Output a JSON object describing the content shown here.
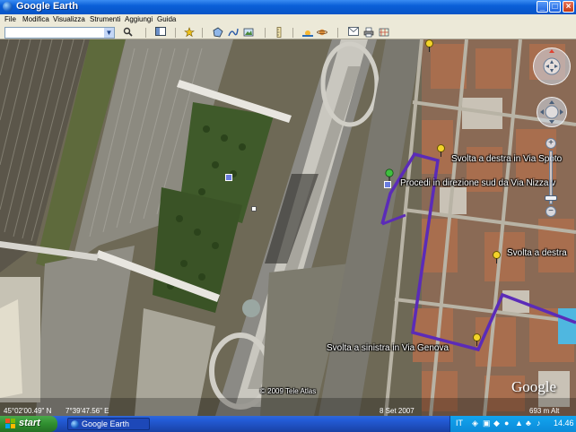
{
  "window": {
    "title": "Google Earth"
  },
  "menu": [
    "File",
    "Modifica",
    "Visualizza",
    "Strumenti",
    "Aggiungi",
    "Guida"
  ],
  "map": {
    "labels": {
      "procedi": "Procedi in direzione sud da Via Nizza v",
      "spotorno": "Svolta a destra in Via Spoto",
      "destra": "Svolta a destra",
      "genova": "Svolta a sinistra in Via Genova"
    },
    "copyright": "© 2009 Tele Atlas",
    "logo": "Google",
    "date": "8 Set 2007",
    "route_color": "#5b2bb8"
  },
  "status": {
    "lat": "45°02'00.49\" N",
    "lon": "7°39'47.56\" E",
    "altitude": "693 m Alt"
  },
  "taskbar": {
    "start": "start",
    "task": "Google Earth",
    "lang": "IT",
    "clock": "14.46"
  }
}
